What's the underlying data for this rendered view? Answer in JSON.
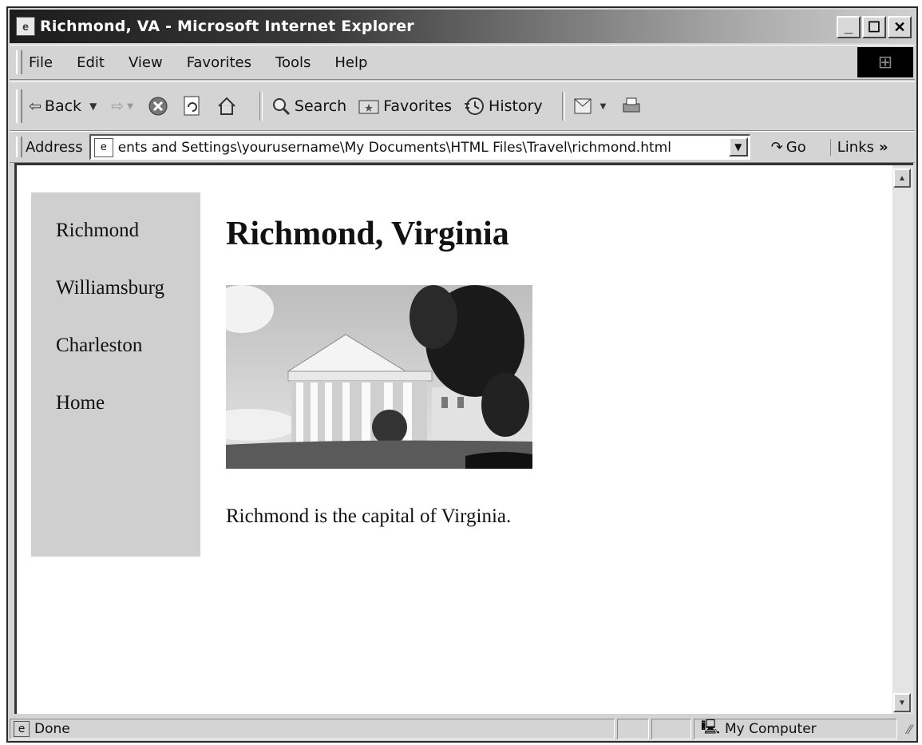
{
  "window": {
    "title": "Richmond, VA - Microsoft Internet Explorer"
  },
  "menu": [
    "File",
    "Edit",
    "View",
    "Favorites",
    "Tools",
    "Help"
  ],
  "toolbar": {
    "back": "Back",
    "search": "Search",
    "favorites": "Favorites",
    "history": "History"
  },
  "address": {
    "label": "Address",
    "value": "ents and Settings\\yourusername\\My Documents\\HTML Files\\Travel\\richmond.html",
    "go": "Go",
    "links": "Links"
  },
  "sidebar": {
    "links": [
      "Richmond",
      "Williamsburg",
      "Charleston",
      "Home"
    ]
  },
  "page": {
    "heading": "Richmond, Virginia",
    "paragraph": "Richmond is the capital of Virginia."
  },
  "status": {
    "text": "Done",
    "zone": "My Computer"
  }
}
